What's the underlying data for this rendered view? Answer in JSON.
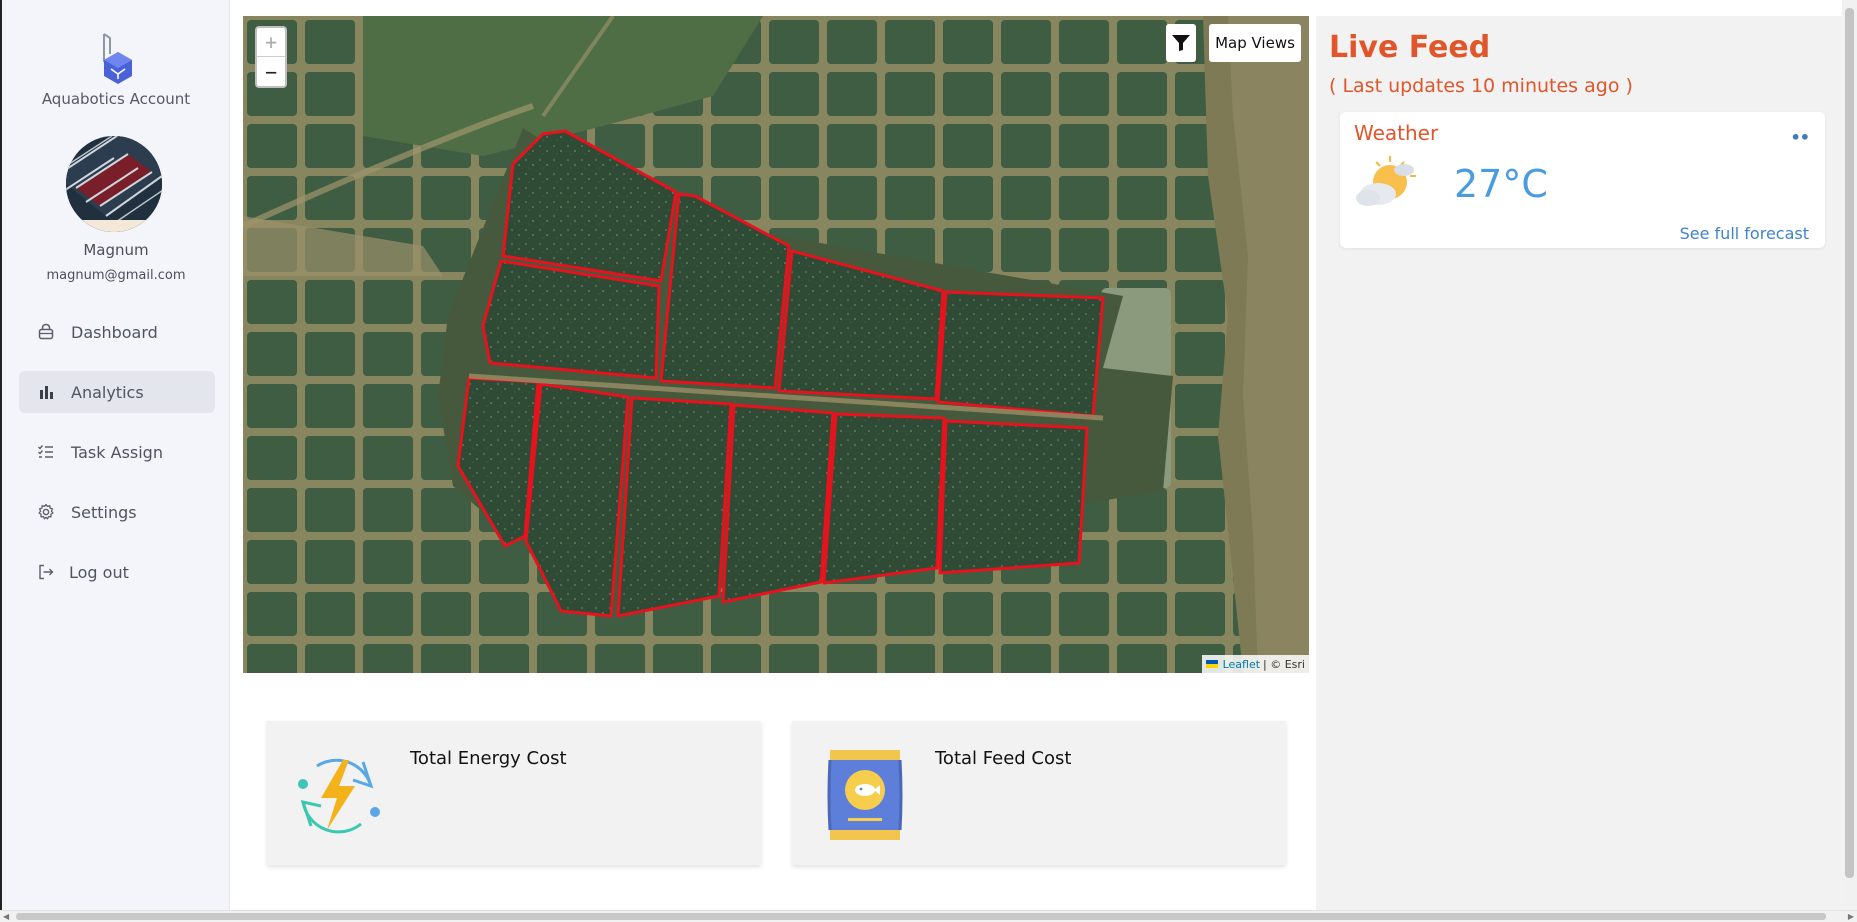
{
  "sidebar": {
    "account_title": "Aquabotics Account",
    "user_name": "Magnum",
    "user_email": "magnum@gmail.com",
    "nav_items": [
      {
        "label": "Dashboard",
        "icon": "lock-bag-icon",
        "active": false
      },
      {
        "label": "Analytics",
        "icon": "bar-chart-icon",
        "active": true
      },
      {
        "label": "Task Assign",
        "icon": "checklist-icon",
        "active": false
      },
      {
        "label": "Settings",
        "icon": "gear-icon",
        "active": false
      },
      {
        "label": "Log out",
        "icon": "logout-icon",
        "active": false
      }
    ]
  },
  "map": {
    "zoom_in": "+",
    "zoom_out": "−",
    "filter_icon": "funnel-icon",
    "map_views_label": "Map Views",
    "attribution_link": "Leaflet",
    "attribution_text": "| © Esri",
    "polygon_color": "#e8121e"
  },
  "cards": {
    "energy": {
      "title": "Total Energy Cost",
      "icon": "lightning-cycle-icon"
    },
    "feed": {
      "title": "Total Feed Cost",
      "icon": "feed-bag-icon"
    }
  },
  "live_feed": {
    "title": "Live Feed",
    "subtitle": "( Last updates 10 minutes ago )",
    "accent_color": "#e0562a",
    "weather": {
      "title": "Weather",
      "menu": "••",
      "icon": "partly-cloudy-sun-icon",
      "temperature": "27°C",
      "forecast_link": "See full forecast"
    }
  }
}
